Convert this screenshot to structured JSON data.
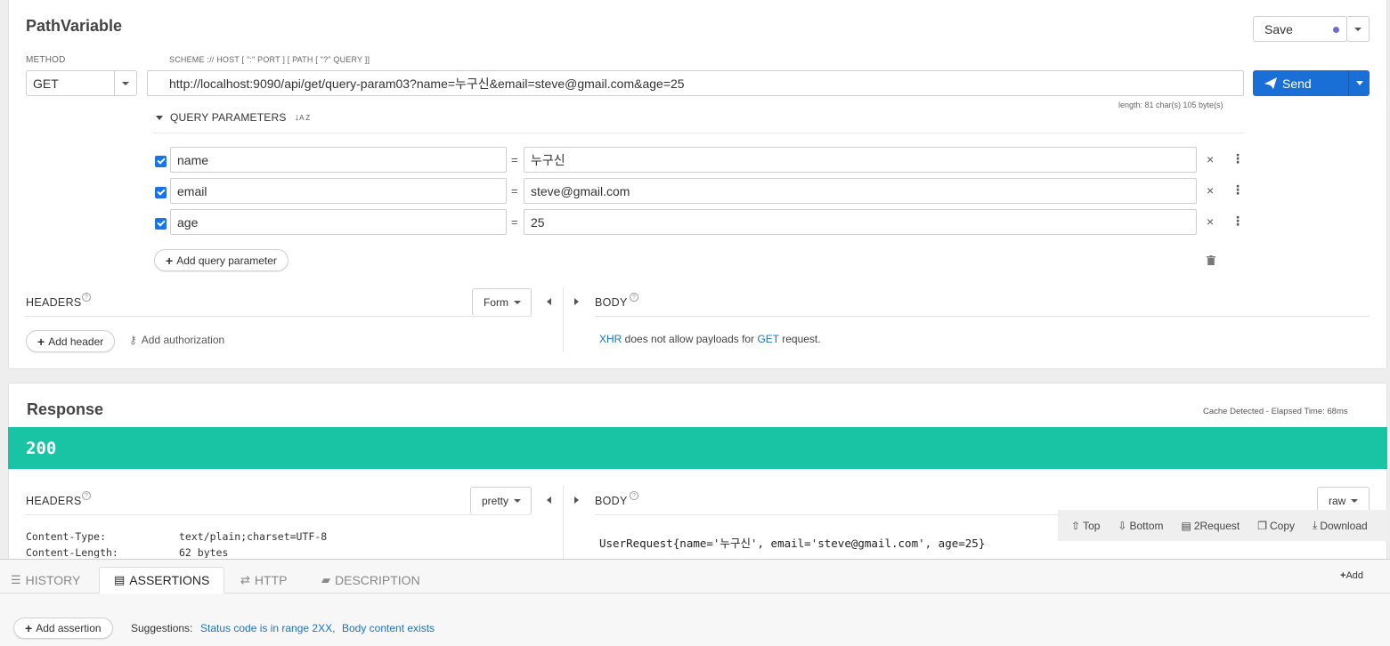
{
  "request": {
    "title": "PathVariable",
    "save_label": "Save",
    "method_label": "METHOD",
    "method_value": "GET",
    "url_label": "SCHEME :// HOST [ \":\" PORT ] [ PATH [ \"?\" QUERY ]]",
    "url_value": "http://localhost:9090/api/get/query-param03?name=누구신&email=steve@gmail.com&age=25",
    "length_info": "length: 81 char(s) 105 byte(s)",
    "send_label": "Send",
    "query_title": "QUERY PARAMETERS",
    "params": [
      {
        "name": "name",
        "value": "누구신"
      },
      {
        "name": "email",
        "value": "steve@gmail.com"
      },
      {
        "name": "age",
        "value": "25"
      }
    ],
    "add_param_label": "Add query parameter",
    "headers_label": "HEADERS",
    "form_label": "Form",
    "body_label": "BODY",
    "add_header_label": "Add header",
    "add_auth_label": "Add authorization",
    "body_note": {
      "xhr": "XHR",
      "mid": " does not allow payloads for ",
      "method": "GET",
      "end": " request."
    }
  },
  "response": {
    "title": "Response",
    "cache_info": "Cache Detected - Elapsed Time: 68ms",
    "status_code": "200",
    "status_color": "#19c4a4",
    "headers_label": "HEADERS",
    "pretty_label": "pretty",
    "body_label": "BODY",
    "raw_label": "raw",
    "headers": [
      {
        "key": "Content-Type:",
        "value": "text/plain;charset=UTF-8"
      },
      {
        "key": "Content-Length:",
        "value": "62 bytes"
      }
    ],
    "body_text": "UserRequest{name='누구신', email='steve@gmail.com', age=25}",
    "toolbar": {
      "top": "Top",
      "bottom": "Bottom",
      "to_request": "2Request",
      "copy": "Copy",
      "download": "Download"
    }
  },
  "bottom": {
    "tabs": {
      "history": "HISTORY",
      "assertions": "ASSERTIONS",
      "http": "HTTP",
      "description": "DESCRIPTION"
    },
    "add_label": "Add",
    "add_assertion_label": "Add assertion",
    "suggestions_label": "Suggestions:",
    "suggestion_1": "Status code is in range 2XX,",
    "suggestion_2": "Body content exists"
  },
  "colors": {
    "accent": "#1a73e8",
    "send": "#1a6fd6",
    "link": "#1a73c6"
  }
}
